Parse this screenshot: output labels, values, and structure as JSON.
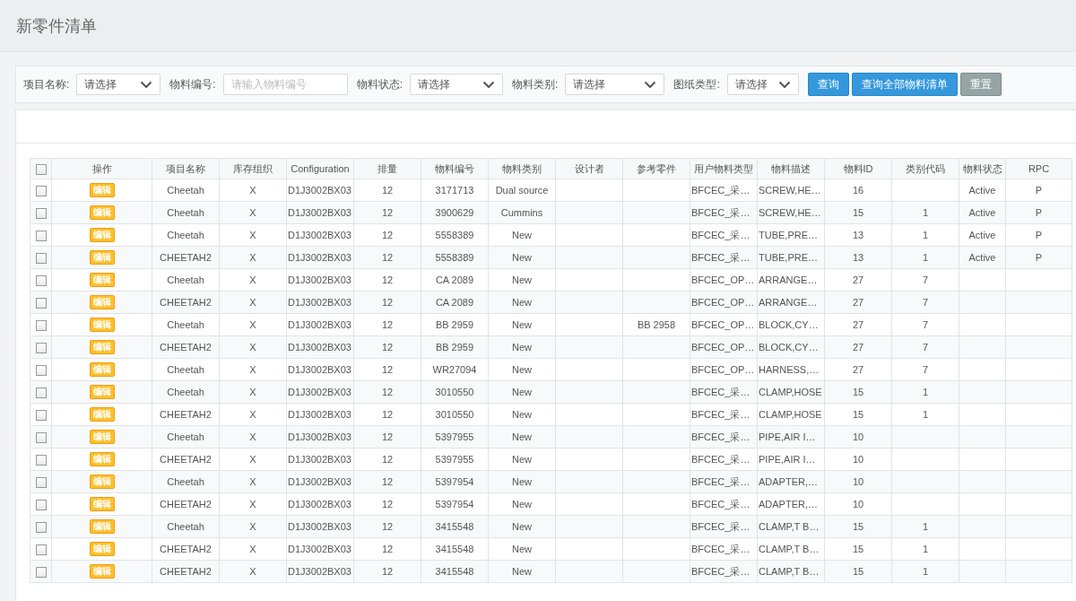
{
  "page": {
    "title": "新零件清单"
  },
  "filters": [
    {
      "kind": "select",
      "label": "项目名称:",
      "value": "请选择"
    },
    {
      "kind": "input",
      "label": "物料编号:",
      "placeholder": "请输入物料编号"
    },
    {
      "kind": "select",
      "label": "物料状态:",
      "value": "请选择"
    },
    {
      "kind": "select",
      "label": "物料类别:",
      "value": "请选择"
    },
    {
      "kind": "select",
      "label": "图纸类型:",
      "value": "请选择"
    }
  ],
  "buttons": [
    {
      "label": "查询",
      "kind": "primary"
    },
    {
      "label": "查询全部物料清单",
      "kind": "primary"
    },
    {
      "label": "重置",
      "kind": "secondary"
    }
  ],
  "table": {
    "select_all": {
      "checked": false
    },
    "columns": [
      "操作",
      "项目名称",
      "库存组织",
      "Configuration",
      "排量",
      "物料编号",
      "物料类别",
      "设计者",
      "参考零件",
      "用户物料类型",
      "物料描述",
      "物料ID",
      "类别代码",
      "物料状态",
      "RPC"
    ],
    "rows": [
      {
        "checked": false,
        "cells": [
          "编辑",
          "Cheetah",
          "X",
          "D1J3002BX03",
          "12",
          "3171713",
          "Dual source",
          null,
          null,
          "BFCEC_采…",
          "SCREW,HE…",
          "16",
          null,
          "Active",
          "P"
        ]
      },
      {
        "checked": false,
        "cells": [
          "编辑",
          "Cheetah",
          "X",
          "D1J3002BX03",
          "12",
          "3900629",
          "Cummins",
          null,
          null,
          "BFCEC_采…",
          "SCREW,HE…",
          "15",
          "1",
          "Active",
          "P"
        ]
      },
      {
        "checked": false,
        "cells": [
          "编辑",
          "Cheetah",
          "X",
          "D1J3002BX03",
          "12",
          "5558389",
          "New",
          null,
          null,
          "BFCEC_采…",
          "TUBE,PRE…",
          "13",
          "1",
          "Active",
          "P"
        ]
      },
      {
        "checked": false,
        "cells": [
          "编辑",
          "CHEETAH2",
          "X",
          "D1J3002BX03",
          "12",
          "5558389",
          "New",
          null,
          null,
          "BFCEC_采…",
          "TUBE,PRE…",
          "13",
          "1",
          "Active",
          "P"
        ]
      },
      {
        "checked": false,
        "cells": [
          "编辑",
          "Cheetah",
          "X",
          "D1J3002BX03",
          "12",
          "CA 2089",
          "New",
          null,
          null,
          "BFCEC_OP…",
          "ARRANGE…",
          "27",
          "7",
          null,
          null
        ]
      },
      {
        "checked": false,
        "cells": [
          "编辑",
          "CHEETAH2",
          "X",
          "D1J3002BX03",
          "12",
          "CA 2089",
          "New",
          null,
          null,
          "BFCEC_OP…",
          "ARRANGE…",
          "27",
          "7",
          null,
          null
        ]
      },
      {
        "checked": false,
        "cells": [
          "编辑",
          "Cheetah",
          "X",
          "D1J3002BX03",
          "12",
          "BB 2959",
          "New",
          null,
          "BB 2958",
          "BFCEC_OP…",
          "BLOCK,CY…",
          "27",
          "7",
          null,
          null
        ]
      },
      {
        "checked": false,
        "cells": [
          "编辑",
          "CHEETAH2",
          "X",
          "D1J3002BX03",
          "12",
          "BB 2959",
          "New",
          null,
          null,
          "BFCEC_OP…",
          "BLOCK,CY…",
          "27",
          "7",
          null,
          null
        ]
      },
      {
        "checked": false,
        "cells": [
          "编辑",
          "Cheetah",
          "X",
          "D1J3002BX03",
          "12",
          "WR27094",
          "New",
          null,
          null,
          "BFCEC_OP…",
          "HARNESS,…",
          "27",
          "7",
          null,
          null
        ]
      },
      {
        "checked": false,
        "cells": [
          "编辑",
          "Cheetah",
          "X",
          "D1J3002BX03",
          "12",
          "3010550",
          "New",
          null,
          null,
          "BFCEC_采…",
          "CLAMP,HOSE",
          "15",
          "1",
          null,
          null
        ]
      },
      {
        "checked": false,
        "cells": [
          "编辑",
          "CHEETAH2",
          "X",
          "D1J3002BX03",
          "12",
          "3010550",
          "New",
          null,
          null,
          "BFCEC_采…",
          "CLAMP,HOSE",
          "15",
          "1",
          null,
          null
        ]
      },
      {
        "checked": false,
        "cells": [
          "编辑",
          "Cheetah",
          "X",
          "D1J3002BX03",
          "12",
          "5397955",
          "New",
          null,
          null,
          "BFCEC_采…",
          "PIPE,AIR I…",
          "10",
          null,
          null,
          null
        ]
      },
      {
        "checked": false,
        "cells": [
          "编辑",
          "CHEETAH2",
          "X",
          "D1J3002BX03",
          "12",
          "5397955",
          "New",
          null,
          null,
          "BFCEC_采…",
          "PIPE,AIR I…",
          "10",
          null,
          null,
          null
        ]
      },
      {
        "checked": false,
        "cells": [
          "编辑",
          "Cheetah",
          "X",
          "D1J3002BX03",
          "12",
          "5397954",
          "New",
          null,
          null,
          "BFCEC_采…",
          "ADAPTER,…",
          "10",
          null,
          null,
          null
        ]
      },
      {
        "checked": false,
        "cells": [
          "编辑",
          "CHEETAH2",
          "X",
          "D1J3002BX03",
          "12",
          "5397954",
          "New",
          null,
          null,
          "BFCEC_采…",
          "ADAPTER,…",
          "10",
          null,
          null,
          null
        ]
      },
      {
        "checked": false,
        "cells": [
          "编辑",
          "Cheetah",
          "X",
          "D1J3002BX03",
          "12",
          "3415548",
          "New",
          null,
          null,
          "BFCEC_采…",
          "CLAMP,T B…",
          "15",
          "1",
          null,
          null
        ]
      },
      {
        "checked": false,
        "cells": [
          "编辑",
          "CHEETAH2",
          "X",
          "D1J3002BX03",
          "12",
          "3415548",
          "New",
          null,
          null,
          "BFCEC_采…",
          "CLAMP,T B…",
          "15",
          "1",
          null,
          null
        ]
      },
      {
        "checked": false,
        "cells": [
          "编辑",
          "CHEETAH2",
          "X",
          "D1J3002BX03",
          "12",
          "3415548",
          "New",
          null,
          null,
          "BFCEC_采…",
          "CLAMP,T B…",
          "15",
          "1",
          null,
          null
        ]
      }
    ]
  }
}
